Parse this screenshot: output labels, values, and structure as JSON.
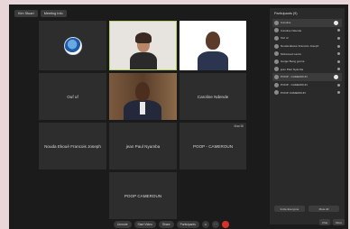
{
  "top_bar": {
    "chip_1": "Kim Stuart",
    "chip_2": "Meeting Info"
  },
  "grid": {
    "tile_logo": "",
    "tile_woman": "",
    "tile_man_glasses": "",
    "tile_ouf": "Ouf uf",
    "tile_suit_man": "",
    "tile_caroline": "Caroline Ndende",
    "tile_nouda": "Nouda Ekouè Francois Joseph",
    "tile_jean_paul": "jean Paul Nyamba",
    "tile_pdp": "POOP - CAMEROUN",
    "tile_pdp_tag": "Mazi Bi",
    "tile_pdp2": "POOP CAMEROUN"
  },
  "participants": {
    "title": "Participants (9)",
    "rows": [
      {
        "name": "Caroline",
        "sub": "Host, me"
      },
      {
        "name": "Caroline Ndende",
        "sub": ""
      },
      {
        "name": "Ouf uf",
        "sub": ""
      },
      {
        "name": "Nouda Ekouè Francois Joseph",
        "sub": ""
      },
      {
        "name": "Mohamed Lamm",
        "sub": ""
      },
      {
        "name": "Guigui Beng gonné",
        "sub": ""
      },
      {
        "name": "jean Paul Nyamba",
        "sub": ""
      },
      {
        "name": "POOP - CAMEROUN",
        "sub": ""
      },
      {
        "name": "POOP - CAMEROUN",
        "sub": ""
      },
      {
        "name": "POOP CAMEROUN",
        "sub": ""
      }
    ],
    "invite_button": "Invite Everyone",
    "mute_all_button": "Mute All",
    "chat_button": "Chat",
    "more_button": "More"
  },
  "controls": {
    "unmute": "Unmute",
    "start_video": "Start Video",
    "share": "Share",
    "participants": "Participants",
    "more_icon": "more-icon",
    "reaction_icon": "reaction-icon",
    "leave_icon": "leave-icon"
  },
  "colors": {
    "background": "#1b1b1b",
    "tile": "#2d2d2d",
    "leave": "#d6322c"
  }
}
